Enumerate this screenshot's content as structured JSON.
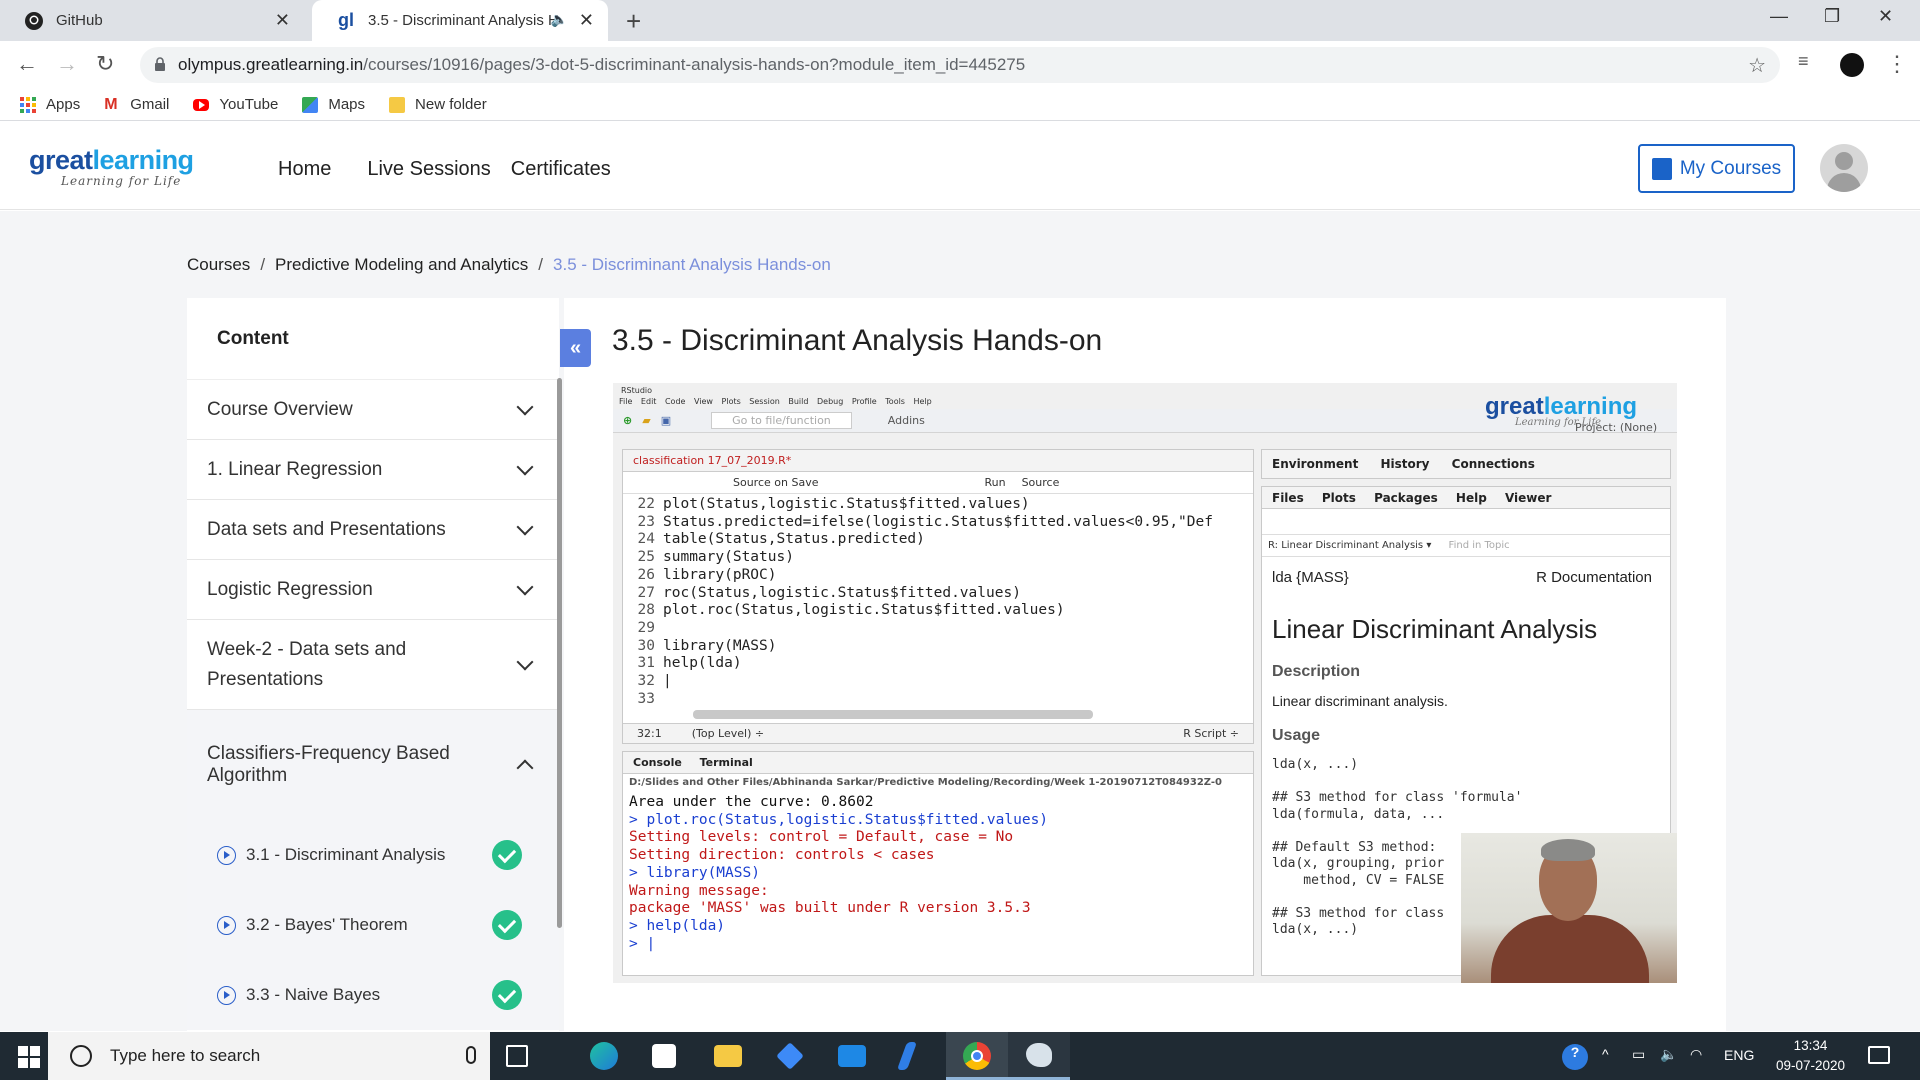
{
  "browser": {
    "tabs": [
      {
        "title": "GitHub",
        "icon": "github-icon"
      },
      {
        "title": "3.5 - Discriminant Analysis H",
        "icon": "greatlearning-icon",
        "active": true
      }
    ],
    "url_host": "olympus.greatlearning.in",
    "url_path": "/courses/10916/pages/3-dot-5-discriminant-analysis-hands-on?module_item_id=445275",
    "bookmarks": [
      "Apps",
      "Gmail",
      "YouTube",
      "Maps",
      "New folder"
    ]
  },
  "site": {
    "brand_part1": "great",
    "brand_part2": "learning",
    "tagline": "Learning for Life",
    "nav": [
      "Home",
      "Live Sessions",
      "Certificates"
    ],
    "my_courses": "My Courses"
  },
  "breadcrumb": {
    "root": "Courses",
    "course": "Predictive Modeling and Analytics",
    "current": "3.5 - Discriminant Analysis Hands-on",
    "sep": "/"
  },
  "sidebar": {
    "heading": "Content",
    "collapse_glyph": "«",
    "modules": [
      "Course Overview",
      "1. Linear Regression",
      "Data sets and Presentations",
      "Logistic Regression",
      "Week-2 - Data sets and Presentations",
      "Classifiers-Frequency Based Algorithm"
    ],
    "lessons": [
      "3.1 - Discriminant Analysis",
      "3.2 - Bayes' Theorem",
      "3.3 - Naive Bayes"
    ]
  },
  "page": {
    "title": "3.5 - Discriminant Analysis Hands-on"
  },
  "rstudio": {
    "window_title": "RStudio",
    "menu": "File Edit Code View Plots Session Build Debug Profile Tools Help",
    "goto_placeholder": "Go to file/function",
    "addins": "Addins",
    "project": "Project: (None)",
    "editor_tab": "classification 17_07_2019.R*",
    "source_on_save": "Source on Save",
    "run": "Run",
    "source": "Source",
    "code": [
      {
        "n": "22",
        "t": "plot(Status,logistic.Status$fitted.values)"
      },
      {
        "n": "23",
        "t": "Status.predicted=ifelse(logistic.Status$fitted.values<0.95,\"Def"
      },
      {
        "n": "24",
        "t": "table(Status,Status.predicted)"
      },
      {
        "n": "25",
        "t": "summary(Status)"
      },
      {
        "n": "26",
        "t": "library(pROC)"
      },
      {
        "n": "27",
        "t": "roc(Status,logistic.Status$fitted.values)"
      },
      {
        "n": "28",
        "t": "plot.roc(Status,logistic.Status$fitted.values)"
      },
      {
        "n": "29",
        "t": ""
      },
      {
        "n": "30",
        "t": "library(MASS)"
      },
      {
        "n": "31",
        "t": "help(lda)"
      },
      {
        "n": "32",
        "t": "|"
      },
      {
        "n": "33",
        "t": ""
      }
    ],
    "cursor_pos": "32:1",
    "scope": "(Top Level) ÷",
    "file_type": "R Script ÷",
    "console_tabs": "Console Terminal",
    "console_path": "D:/Slides and Other Files/Abhinanda Sarkar/Predictive Modeling/Recording/Week 1-20190712T084932Z-0",
    "console": [
      {
        "c": "blk",
        "t": "Area under the curve: 0.8602"
      },
      {
        "c": "blue",
        "t": "> plot.roc(Status,logistic.Status$fitted.values)"
      },
      {
        "c": "red",
        "t": "Setting levels: control = Default, case = No"
      },
      {
        "c": "red",
        "t": "Setting direction: controls < cases"
      },
      {
        "c": "blue",
        "t": "> library(MASS)"
      },
      {
        "c": "red",
        "t": "Warning message:"
      },
      {
        "c": "red",
        "t": "package 'MASS' was built under R version 3.5.3"
      },
      {
        "c": "blue",
        "t": "> help(lda)"
      },
      {
        "c": "blue",
        "t": "> |"
      }
    ],
    "env_tabs": "Environment History Connections",
    "help_tabs": "Files Plots Packages Help Viewer",
    "help_topic": "R: Linear Discriminant Analysis ▾",
    "find_in_topic": "Find in Topic",
    "help_pkg": "lda {MASS}",
    "help_doc": "R Documentation",
    "help_title": "Linear Discriminant Analysis",
    "desc_heading": "Description",
    "desc_text": "Linear discriminant analysis.",
    "usage_heading": "Usage",
    "usage_code": "lda(x, ...)\n\n## S3 method for class 'formula'\nlda(formula, data, ...\n\n## Default S3 method:\nlda(x, grouping, prior\n    method, CV = FALSE\n\n## S3 method for class\nlda(x, ...)"
  },
  "taskbar": {
    "search_placeholder": "Type here to search",
    "lang": "ENG",
    "time": "13:34",
    "date": "09-07-2020"
  }
}
